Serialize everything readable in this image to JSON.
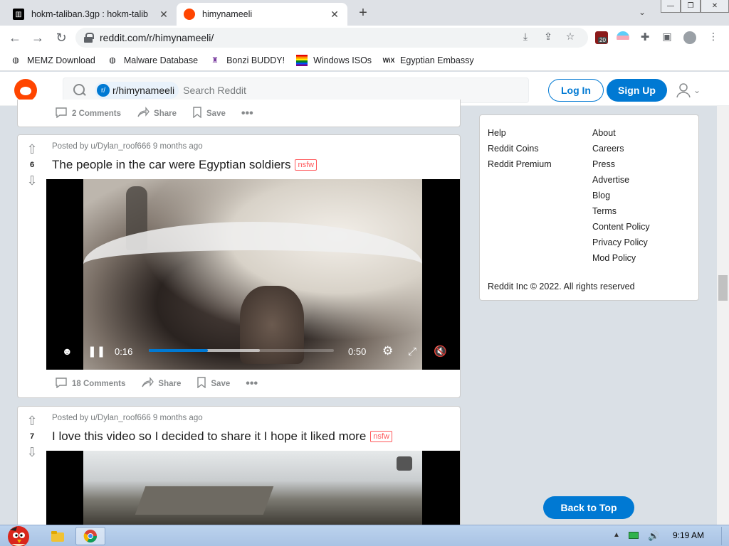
{
  "browser": {
    "tabs": [
      {
        "title": "hokm-taliban.3gp : hokm-talib",
        "active": false
      },
      {
        "title": "himynameeli",
        "active": true
      }
    ],
    "url": "reddit.com/r/himynameeli/",
    "extension_badge": "20",
    "bookmarks": [
      {
        "label": "MEMZ Download",
        "icon": "globe-icon"
      },
      {
        "label": "Malware Database",
        "icon": "globe-icon"
      },
      {
        "label": "Bonzi BUDDY!",
        "icon": "bonzi-icon"
      },
      {
        "label": "Windows ISOs",
        "icon": "windows-flag-icon"
      },
      {
        "label": "Egyptian Embassy",
        "icon": "wix-icon"
      }
    ]
  },
  "reddit": {
    "subreddit_chip": "r/himynameeli",
    "search_placeholder": "Search Reddit",
    "login_label": "Log In",
    "signup_label": "Sign Up",
    "back_to_top": "Back to Top",
    "accent": "#0079d3",
    "brand": "#ff4500"
  },
  "feed": {
    "top_partial_post": {
      "comments": "2 Comments",
      "share": "Share",
      "save": "Save"
    },
    "posts": [
      {
        "votes": "6",
        "meta": "Posted by u/Dylan_roof666 9 months ago",
        "title": "The people in the car were Egyptian soldiers",
        "flair": "nsfw",
        "video": {
          "current": "0:16",
          "duration": "0:50",
          "progress": 0.32
        },
        "comments": "18 Comments",
        "share": "Share",
        "save": "Save"
      },
      {
        "votes": "7",
        "meta": "Posted by u/Dylan_roof666 9 months ago",
        "title": "I love this video so I decided to share it I hope it liked more",
        "flair": "nsfw"
      }
    ]
  },
  "sidebar": {
    "col1": [
      "Help",
      "Reddit Coins",
      "Reddit Premium"
    ],
    "col2": [
      "About",
      "Careers",
      "Press",
      "Advertise",
      "Blog",
      "Terms",
      "Content Policy",
      "Privacy Policy",
      "Mod Policy"
    ],
    "copyright": "Reddit Inc © 2022. All rights reserved"
  },
  "taskbar": {
    "time": "9:19 AM"
  }
}
